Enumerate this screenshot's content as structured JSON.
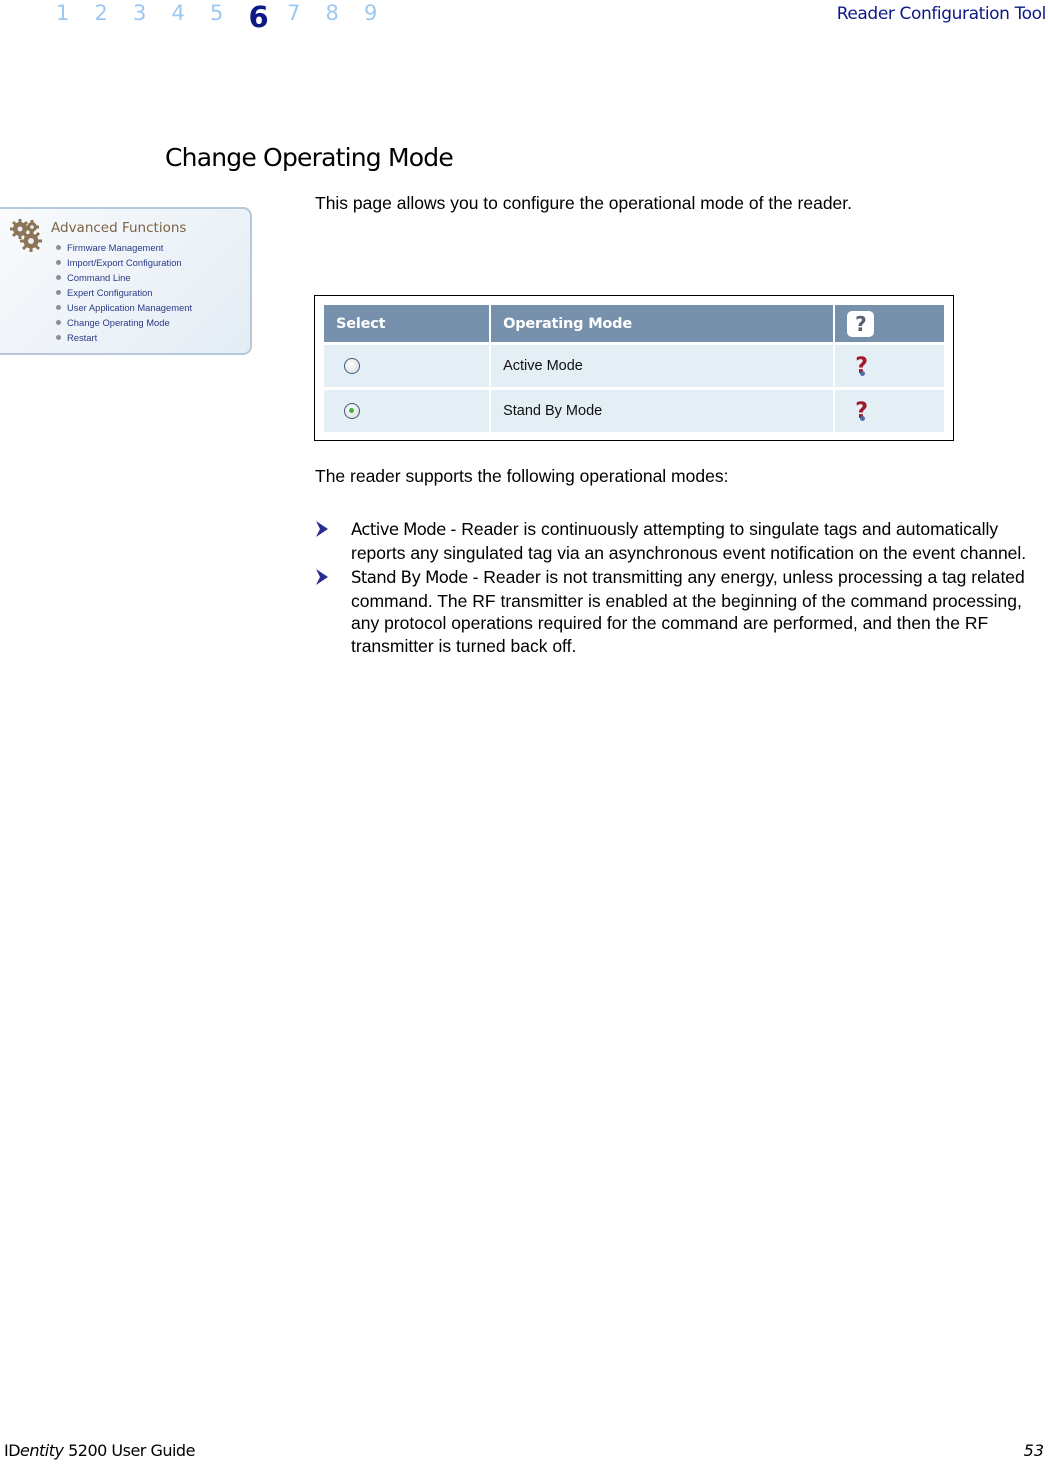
{
  "header": {
    "chapters": [
      "1",
      "2",
      "3",
      "4",
      "5",
      "6",
      "7",
      "8",
      "9"
    ],
    "active_chapter": "6",
    "running_title": "Reader Configuration Tool"
  },
  "section": {
    "title": "Change Operating Mode",
    "intro": "This page allows you to configure the operational mode of the reader."
  },
  "side_menu": {
    "icon": "gears-icon",
    "title": "Advanced Functions",
    "items": [
      "Firmware Management",
      "Import/Export Configuration",
      "Command Line",
      "Expert Configuration",
      "User Application Management",
      "Change Operating Mode",
      "Restart"
    ]
  },
  "mode_table": {
    "headers": [
      "Select",
      "Operating Mode",
      "?"
    ],
    "rows": [
      {
        "mode": "Active Mode",
        "selected": false,
        "help": "?"
      },
      {
        "mode": "Stand By Mode",
        "selected": true,
        "help": "?"
      }
    ]
  },
  "body": {
    "supports_text": "The reader supports the following operational modes:",
    "bullets": [
      {
        "term": "Active Mode",
        "text": " - Reader is continuously attempting to singulate tags and automatically reports any singulated tag via an asynchronous event notification on the event channel."
      },
      {
        "term": "Stand By Mode",
        "text": " - Reader is not transmitting any energy, unless processing a tag related command. The RF transmitter is enabled at the beginning of the command processing, any protocol operations required for the command are performed, and then the RF transmitter is turned back off."
      }
    ]
  },
  "footer": {
    "product_prefix": "ID",
    "product_italic": "entity",
    "product_suffix": " 5200 User Guide",
    "page_number": "53"
  },
  "colors": {
    "chapter_active": "#0d1a86",
    "chapter_inactive": "#9cc8f2",
    "table_header": "#7790ab",
    "table_row": "#e4eff5",
    "bullet_chevron": "#2a2f8f"
  }
}
